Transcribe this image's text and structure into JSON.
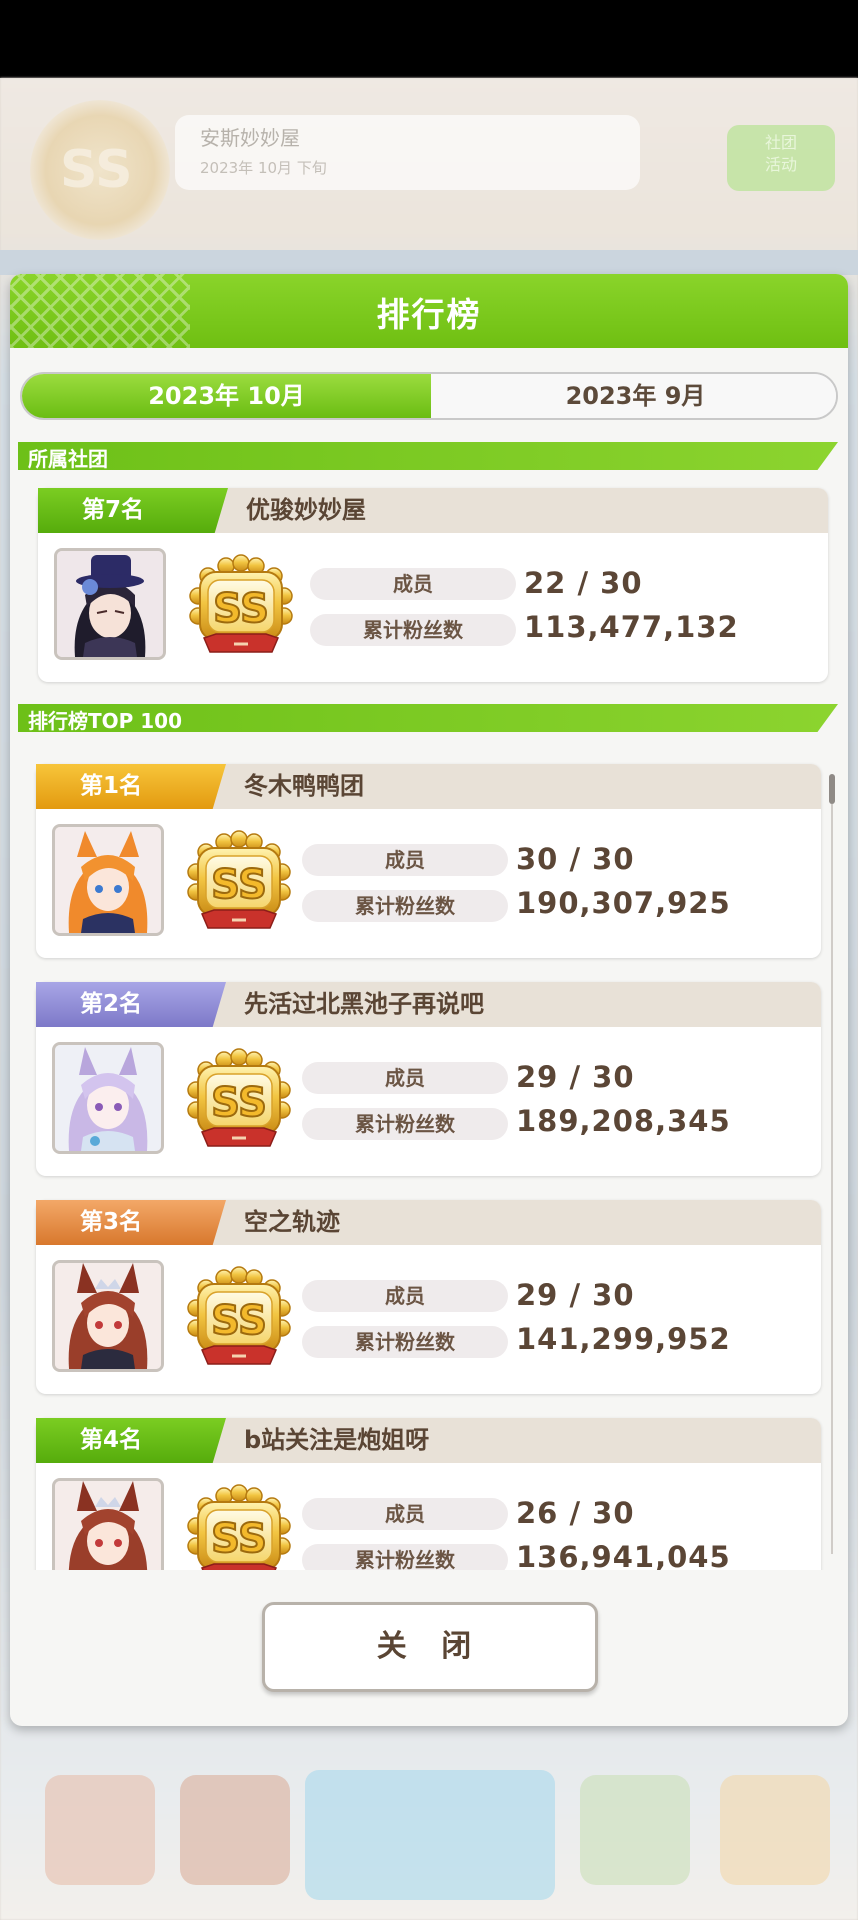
{
  "background": {
    "club_badge": "SS",
    "club_name": "安斯妙妙屋",
    "club_sub": "2023年 10月 下旬",
    "right_button": "社团 活动"
  },
  "modal": {
    "title": "排行榜",
    "tabs": [
      {
        "label": "2023年 10月",
        "active": true
      },
      {
        "label": "2023年 9月",
        "active": false
      }
    ],
    "my_club_section": "所属社团",
    "my_club": {
      "rank": "第7名",
      "name": "优骏妙妙屋",
      "emblem": "SS",
      "members_label": "成员",
      "members": "22 / 30",
      "fans_label": "累计粉丝数",
      "fans": "113,477,132"
    },
    "top_section": "排行榜TOP 100",
    "ranking": [
      {
        "rank": "第1名",
        "name": "冬木鸭鸭团",
        "emblem": "SS",
        "members_label": "成员",
        "members": "30 / 30",
        "fans_label": "累计粉丝数",
        "fans": "190,307,925",
        "tier": "gold",
        "avatar": "orange-hair-horse-girl"
      },
      {
        "rank": "第2名",
        "name": "先活过北黑池子再说吧",
        "emblem": "SS",
        "members_label": "成员",
        "members": "29 / 30",
        "fans_label": "累计粉丝数",
        "fans": "189,208,345",
        "tier": "silver",
        "avatar": "lilac-hair-horse-girl"
      },
      {
        "rank": "第3名",
        "name": "空之轨迹",
        "emblem": "SS",
        "members_label": "成员",
        "members": "29 / 30",
        "fans_label": "累计粉丝数",
        "fans": "141,299,952",
        "tier": "bronze",
        "avatar": "brown-hair-tiara-horse-girl"
      },
      {
        "rank": "第4名",
        "name": "b站关注是炮姐呀",
        "emblem": "SS",
        "members_label": "成员",
        "members": "26 / 30",
        "fans_label": "累计粉丝数",
        "fans": "136,941,045",
        "tier": "green",
        "avatar": "brown-hair-tiara-horse-girl"
      }
    ],
    "close_button": "关 闭"
  },
  "colors": {
    "accent_green": "#6fbf12",
    "text_brown": "#5a4534",
    "gold": "#e39a10",
    "silver": "#7d79c8",
    "bronze": "#d8782d"
  }
}
